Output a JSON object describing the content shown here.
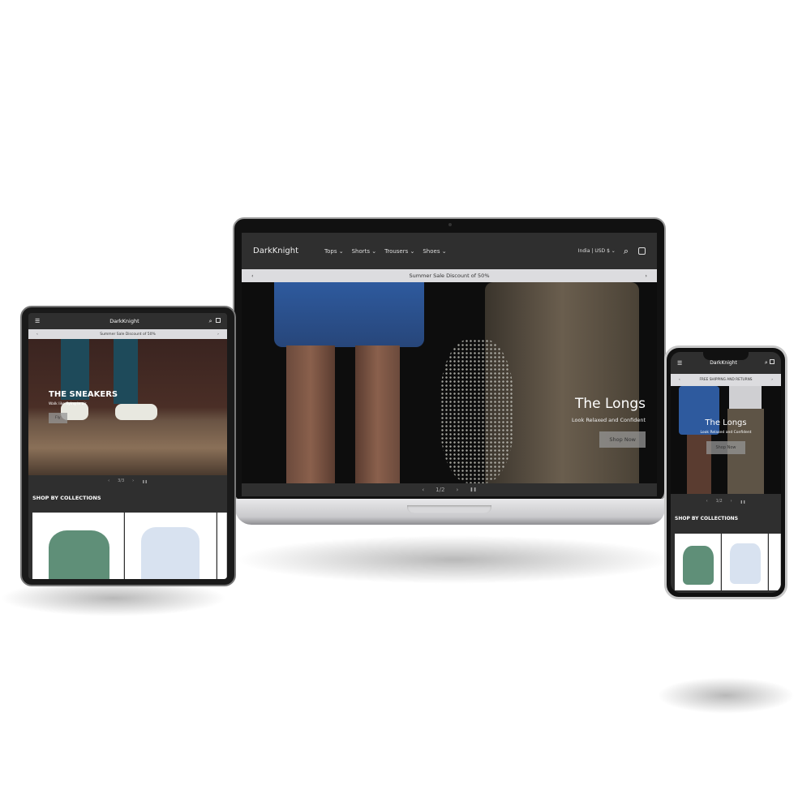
{
  "brand": "DarkKnight",
  "laptop": {
    "nav": [
      "Tops",
      "Shorts",
      "Trousers",
      "Shoes"
    ],
    "locale": "India | USD $",
    "announcement": "Summer Sale Discount of 50%",
    "hero_title": "The Longs",
    "hero_subtitle": "Look Relaxed and Confident",
    "hero_button": "Shop Now",
    "slide_counter": "1/2"
  },
  "tablet": {
    "announcement": "Summer Sale Discount of 50%",
    "hero_title": "THE SNEAKERS",
    "hero_subtitle": "Walk like flying in air",
    "hero_button": "Fly",
    "slide_counter": "3/3",
    "section_title": "SHOP BY COLLECTIONS"
  },
  "phone": {
    "announcement": "FREE SHIPPING AND RETURNS",
    "hero_title": "The Longs",
    "hero_subtitle": "Look Relaxed and Confident",
    "hero_button": "Shop Now",
    "slide_counter": "1/2",
    "section_title": "SHOP BY COLLECTIONS"
  },
  "icons": {
    "prev": "‹",
    "next": "›",
    "pause": "❚❚",
    "chevron": "⌄",
    "menu": "☰",
    "search": "⌕",
    "cart": "🛍"
  }
}
